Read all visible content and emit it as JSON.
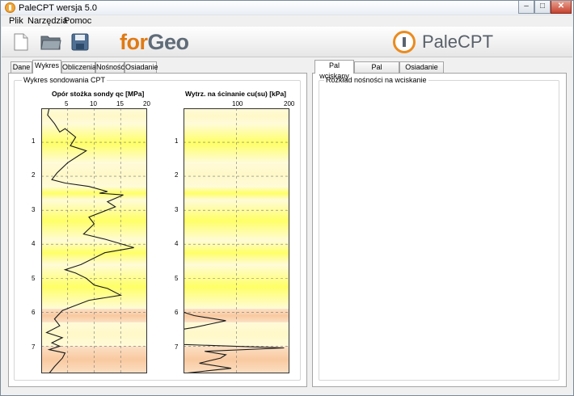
{
  "window": {
    "title": "PaleCPT wersja 5.0",
    "controls": {
      "minimize": "–",
      "maximize": "□",
      "close": "✕"
    }
  },
  "menu": [
    {
      "label": "Plik"
    },
    {
      "label": "Narzędzia"
    },
    {
      "label": "Pomoc"
    }
  ],
  "toolbar": {
    "buttons": [
      "new-file-icon",
      "open-folder-icon",
      "save-icon"
    ],
    "forgeo_logo": {
      "part1": "for",
      "part2": "Geo"
    },
    "pale_logo": "PaleCPT"
  },
  "left_tabs": [
    {
      "label": "Dane",
      "active": false
    },
    {
      "label": "Wykres",
      "active": true
    },
    {
      "label": "Obliczenia",
      "active": false
    },
    {
      "label": "Nośność",
      "active": false
    },
    {
      "label": "Osiadanie",
      "active": false
    }
  ],
  "right_tabs": [
    {
      "label": "Pal wciskany",
      "active": true
    },
    {
      "label": "Pal wyciągany",
      "active": false
    },
    {
      "label": "Osiadanie pala",
      "active": false
    }
  ],
  "left_group_title": "Wykres sondowania CPT",
  "right_group_title": "Rozkład nośności na wciskanie",
  "colors": {
    "layer_yellow": "#ffff66",
    "layer_light": "#fff8c8",
    "layer_orange": "#f9c9a0",
    "curve": "#1a1a1a"
  },
  "chart_data": [
    {
      "type": "line",
      "title": "Opór stożka sondy qc [MPa]",
      "x_ticks": [
        "5",
        "10",
        "15",
        "20"
      ],
      "y_ticks": [
        "1",
        "2",
        "3",
        "4",
        "5",
        "6",
        "7"
      ],
      "xlim": [
        0,
        20
      ],
      "ylim": [
        0,
        7.8
      ],
      "layers": [
        {
          "from": 0.0,
          "to": 0.45,
          "kind": "light"
        },
        {
          "from": 0.45,
          "to": 1.6,
          "kind": "yellow"
        },
        {
          "from": 1.6,
          "to": 2.3,
          "kind": "light"
        },
        {
          "from": 2.3,
          "to": 2.7,
          "kind": "yellow"
        },
        {
          "from": 2.7,
          "to": 3.9,
          "kind": "yellow"
        },
        {
          "from": 3.9,
          "to": 4.6,
          "kind": "yellow"
        },
        {
          "from": 4.6,
          "to": 5.9,
          "kind": "yellow"
        },
        {
          "from": 5.9,
          "to": 6.3,
          "kind": "orange"
        },
        {
          "from": 6.3,
          "to": 7.0,
          "kind": "light"
        },
        {
          "from": 7.0,
          "to": 7.8,
          "kind": "orange"
        }
      ],
      "points": [
        [
          1.5,
          0.0
        ],
        [
          1.2,
          0.2
        ],
        [
          2.5,
          0.45
        ],
        [
          3.5,
          0.7
        ],
        [
          4.5,
          0.6
        ],
        [
          6.5,
          0.85
        ],
        [
          5.5,
          1.1
        ],
        [
          8.5,
          1.25
        ],
        [
          7.0,
          1.4
        ],
        [
          5.0,
          1.6
        ],
        [
          3.0,
          1.9
        ],
        [
          2.0,
          2.1
        ],
        [
          4.5,
          2.2
        ],
        [
          9.0,
          2.3
        ],
        [
          12.5,
          2.45
        ],
        [
          11.0,
          2.5
        ],
        [
          15.5,
          2.55
        ],
        [
          12.5,
          2.75
        ],
        [
          14.0,
          2.9
        ],
        [
          9.0,
          3.2
        ],
        [
          10.0,
          3.4
        ],
        [
          8.0,
          3.7
        ],
        [
          12.0,
          3.85
        ],
        [
          17.5,
          4.1
        ],
        [
          12.0,
          4.25
        ],
        [
          7.5,
          4.6
        ],
        [
          4.5,
          4.75
        ],
        [
          6.5,
          4.85
        ],
        [
          8.5,
          5.0
        ],
        [
          10.0,
          5.2
        ],
        [
          12.5,
          5.3
        ],
        [
          15.0,
          5.5
        ],
        [
          9.0,
          5.65
        ],
        [
          6.5,
          5.8
        ],
        [
          4.0,
          5.95
        ],
        [
          2.5,
          6.2
        ],
        [
          3.5,
          6.4
        ],
        [
          1.0,
          6.6
        ],
        [
          4.0,
          6.75
        ],
        [
          2.0,
          6.9
        ],
        [
          3.5,
          7.0
        ],
        [
          1.5,
          7.1
        ],
        [
          4.5,
          7.2
        ],
        [
          4.0,
          7.35
        ],
        [
          2.5,
          7.6
        ],
        [
          1.5,
          7.8
        ]
      ]
    },
    {
      "type": "line",
      "title": "Wytrz. na ścinanie cu(su) [kPa]",
      "x_ticks": [
        "100",
        "200"
      ],
      "y_ticks": [
        "1",
        "2",
        "3",
        "4",
        "5",
        "6",
        "7"
      ],
      "xlim": [
        0,
        200
      ],
      "ylim": [
        0,
        7.8
      ],
      "layers": [
        {
          "from": 0.0,
          "to": 0.45,
          "kind": "light"
        },
        {
          "from": 0.45,
          "to": 1.6,
          "kind": "yellow"
        },
        {
          "from": 1.6,
          "to": 2.3,
          "kind": "light"
        },
        {
          "from": 2.3,
          "to": 2.7,
          "kind": "yellow"
        },
        {
          "from": 2.7,
          "to": 3.9,
          "kind": "yellow"
        },
        {
          "from": 3.9,
          "to": 4.6,
          "kind": "yellow"
        },
        {
          "from": 4.6,
          "to": 5.9,
          "kind": "yellow"
        },
        {
          "from": 5.9,
          "to": 6.3,
          "kind": "orange"
        },
        {
          "from": 6.3,
          "to": 7.0,
          "kind": "light"
        },
        {
          "from": 7.0,
          "to": 7.8,
          "kind": "orange"
        }
      ],
      "points": [
        [
          0,
          6.0
        ],
        [
          20,
          6.1
        ],
        [
          80,
          6.25
        ],
        [
          50,
          6.35
        ],
        [
          20,
          6.45
        ],
        [
          0,
          6.5
        ],
        [
          0,
          6.95
        ],
        [
          190,
          7.05
        ],
        [
          40,
          7.15
        ],
        [
          80,
          7.25
        ],
        [
          70,
          7.35
        ],
        [
          30,
          7.5
        ],
        [
          90,
          7.65
        ],
        [
          30,
          7.75
        ],
        [
          0,
          7.8
        ]
      ]
    }
  ]
}
